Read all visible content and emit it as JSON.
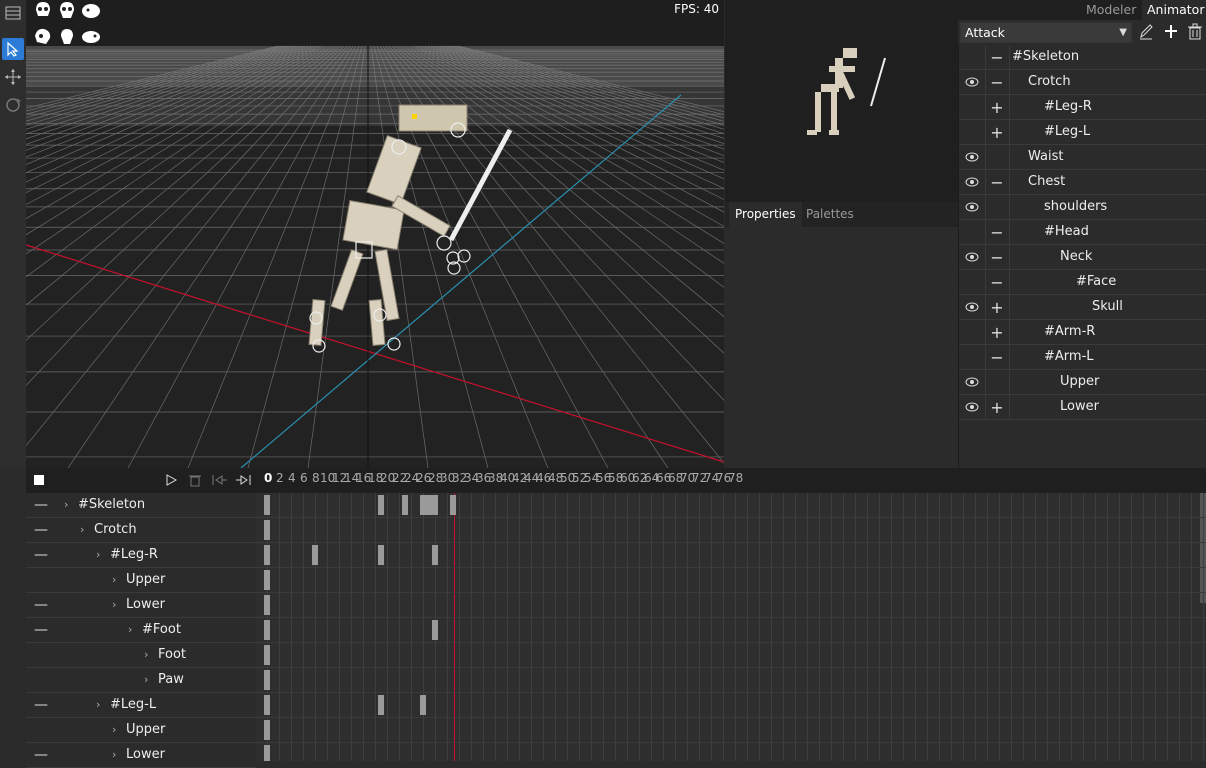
{
  "viewport": {
    "fps": "FPS: 40"
  },
  "right_panel": {
    "tabs": [
      {
        "label": "Modeler",
        "active": false
      },
      {
        "label": "Animator",
        "active": true
      }
    ],
    "animation_select": "Attack",
    "bones": [
      {
        "label": "#Skeleton",
        "eye": false,
        "sign": "−",
        "indent": 0
      },
      {
        "label": "Crotch",
        "eye": true,
        "sign": "−",
        "indent": 1
      },
      {
        "label": "#Leg-R",
        "eye": false,
        "sign": "+",
        "indent": 2
      },
      {
        "label": "#Leg-L",
        "eye": false,
        "sign": "+",
        "indent": 2
      },
      {
        "label": "Waist",
        "eye": true,
        "sign": "",
        "indent": 1
      },
      {
        "label": "Chest",
        "eye": true,
        "sign": "−",
        "indent": 1
      },
      {
        "label": "shoulders",
        "eye": true,
        "sign": "",
        "indent": 2
      },
      {
        "label": "#Head",
        "eye": false,
        "sign": "−",
        "indent": 2
      },
      {
        "label": "Neck",
        "eye": true,
        "sign": "−",
        "indent": 3
      },
      {
        "label": "#Face",
        "eye": false,
        "sign": "−",
        "indent": 4
      },
      {
        "label": "Skull",
        "eye": true,
        "sign": "+",
        "indent": 5
      },
      {
        "label": "#Arm-R",
        "eye": false,
        "sign": "+",
        "indent": 2
      },
      {
        "label": "#Arm-L",
        "eye": false,
        "sign": "−",
        "indent": 2
      },
      {
        "label": "Upper",
        "eye": true,
        "sign": "",
        "indent": 3
      },
      {
        "label": "Lower",
        "eye": true,
        "sign": "+",
        "indent": 3
      }
    ]
  },
  "properties_tabs": [
    {
      "label": "Properties",
      "active": true
    },
    {
      "label": "Palettes",
      "active": false
    }
  ],
  "timeline": {
    "ticks": [
      "0",
      "2",
      "4",
      "6",
      "8",
      "10",
      "12",
      "14",
      "16",
      "18",
      "20",
      "22",
      "24",
      "26",
      "28",
      "30",
      "32",
      "34",
      "36",
      "38",
      "40",
      "42",
      "44",
      "46",
      "48",
      "50",
      "52",
      "54",
      "56",
      "58",
      "60",
      "62",
      "64",
      "66",
      "68",
      "70",
      "72",
      "74",
      "76",
      "78"
    ],
    "current_frame": 31,
    "tracks": [
      {
        "label": "#Skeleton",
        "minus": true,
        "level": 0,
        "keys": [
          0,
          19,
          23,
          26,
          27,
          28,
          31
        ]
      },
      {
        "label": "Crotch",
        "minus": true,
        "level": 1,
        "keys": [
          0
        ]
      },
      {
        "label": "#Leg-R",
        "minus": true,
        "level": 2,
        "keys": [
          0,
          8,
          19,
          28
        ]
      },
      {
        "label": "Upper",
        "minus": false,
        "level": 3,
        "keys": [
          0
        ]
      },
      {
        "label": "Lower",
        "minus": true,
        "level": 3,
        "keys": [
          0
        ]
      },
      {
        "label": "#Foot",
        "minus": true,
        "level": 4,
        "keys": [
          0,
          28
        ]
      },
      {
        "label": "Foot",
        "minus": false,
        "level": 5,
        "keys": [
          0
        ]
      },
      {
        "label": "Paw",
        "minus": false,
        "level": 5,
        "keys": [
          0
        ]
      },
      {
        "label": "#Leg-L",
        "minus": true,
        "level": 2,
        "keys": [
          0,
          19,
          26
        ]
      },
      {
        "label": "Upper",
        "minus": false,
        "level": 3,
        "keys": [
          0
        ]
      },
      {
        "label": "Lower",
        "minus": true,
        "level": 3,
        "keys": [
          0
        ]
      }
    ]
  }
}
